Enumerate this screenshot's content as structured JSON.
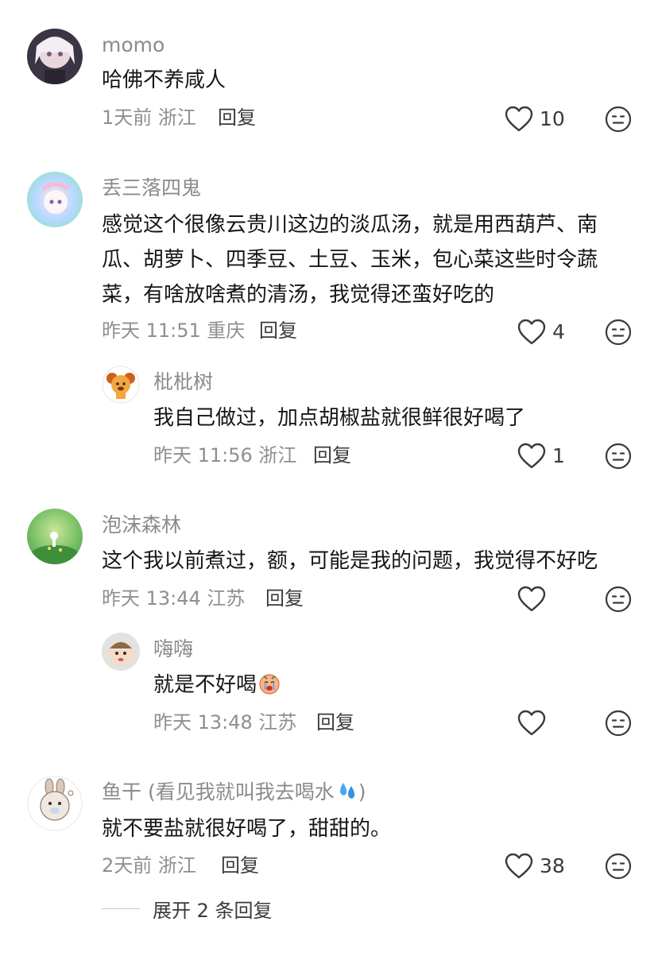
{
  "comments": [
    {
      "username": "momo",
      "lines": [
        "哈佛不养咸人"
      ],
      "meta": "1天前 浙江",
      "reply_label": "回复",
      "likes": "10"
    },
    {
      "username": "丢三落四鬼",
      "lines": [
        "感觉这个很像云贵川这边的淡瓜汤，就是用西葫芦、南",
        "瓜、胡萝卜、四季豆、土豆、玉米，包心菜这些时令蔬",
        "菜，有啥放啥煮的清汤，我觉得还蛮好吃的"
      ],
      "meta": "昨天 11:51 重庆",
      "reply_label": "回复",
      "likes": "4",
      "replies": [
        {
          "username": "枇枇树",
          "lines": [
            "我自己做过，加点胡椒盐就很鲜很好喝了"
          ],
          "meta": "昨天 11:56 浙江",
          "reply_label": "回复",
          "likes": "1"
        }
      ]
    },
    {
      "username": "泡沫森林",
      "lines": [
        "这个我以前煮过，额，可能是我的问题，我觉得不好吃"
      ],
      "meta": "昨天 13:44 江苏",
      "reply_label": "回复",
      "likes": "",
      "replies": [
        {
          "username": "嗨嗨",
          "lines": [
            "就是不好喝"
          ],
          "emoji": "crying-face-emoji",
          "meta": "昨天 13:48 江苏",
          "reply_label": "回复",
          "likes": ""
        }
      ]
    },
    {
      "username": "鱼干 (看见我就叫我去喝水",
      "username_suffix": ")",
      "username_emoji": "sweat-droplets-emoji",
      "lines": [
        "就不要盐就很好喝了，甜甜的。"
      ],
      "meta": "2天前 浙江",
      "reply_label": "回复",
      "likes": "38",
      "expand_label": "展开 2 条回复"
    }
  ],
  "colors": {
    "meta_gray": "#8f8f8f",
    "username_gray": "#8b8b8b",
    "icon_dark": "#3a3a3a"
  }
}
